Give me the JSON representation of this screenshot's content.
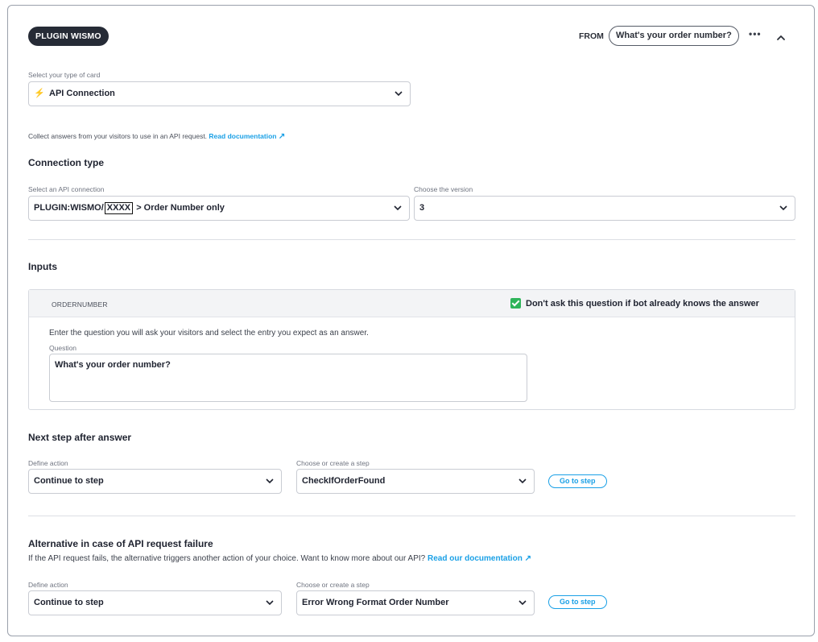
{
  "header": {
    "plugin_name": "PLUGIN WISMO",
    "from_label": "FROM",
    "from_value": "What's your order number?",
    "more_icon": "more-horizontal-icon",
    "collapse_icon": "chevron-up-icon"
  },
  "card_type": {
    "label": "Select your type of card",
    "value": "API Connection",
    "icon": "bolt-icon",
    "helper": "Collect answers from your visitors to use in an API request.",
    "doc_link": "Read documentation"
  },
  "connection": {
    "title": "Connection type",
    "api_label": "Select an API connection",
    "api_prefix": "PLUGIN:WISMO/",
    "api_masked": "XXXX",
    "api_suffix": "> Order Number only",
    "version_label": "Choose the version",
    "version_value": "3"
  },
  "inputs": {
    "title": "Inputs",
    "param_name": "ORDERNUMBER",
    "skip_label": "Don't ask this question if bot already knows the answer",
    "skip_checked": true,
    "instruction": "Enter the question you will ask your visitors and select the entry you expect as an answer.",
    "question_label": "Question",
    "question_value": "What's your order number?"
  },
  "next_step": {
    "title": "Next step after answer",
    "action_label": "Define action",
    "action_value": "Continue to step",
    "step_label": "Choose or create a step",
    "step_value": "CheckIfOrderFound",
    "goto_label": "Go to step"
  },
  "fallback": {
    "title": "Alternative in case of API request failure",
    "description": "If the API request fails, the alternative triggers another action of your choice. Want to know more about our API?",
    "doc_link": "Read our documentation",
    "action_label": "Define action",
    "action_value": "Continue to step",
    "step_label": "Choose or create a step",
    "step_value": "Error Wrong Format Order Number",
    "goto_label": "Go to step"
  },
  "colors": {
    "accent": "#1aa0e6",
    "pill_dark": "#262b36",
    "check_green": "#2fb45a",
    "bolt_purple": "#3b2fc9"
  }
}
